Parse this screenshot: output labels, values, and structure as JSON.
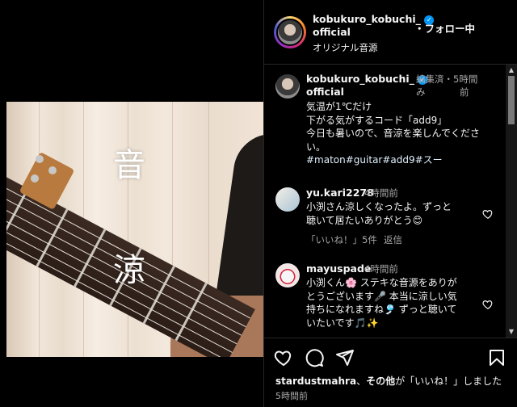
{
  "post": {
    "username_line1": "kobukuro_kobuchi_",
    "username_line2": "official",
    "follow_label": "・フォロー中",
    "audio_label": "オリジナル音源"
  },
  "overlay": {
    "char1": "音",
    "char2": "涼"
  },
  "caption": {
    "username_line1": "kobukuro_kobuchi_",
    "username_line2": "official",
    "edited_label": "編集済",
    "edited_label_2": "み",
    "dot": "・",
    "time_line1": "5時間",
    "time_line2": "前",
    "lines": [
      "気温が1℃だけ",
      "下がる気がするコード「add9」",
      "今日も暑いので、音涼を楽しんでくださ",
      "い。"
    ],
    "hashtags": "#maton#guitar#add9#スー"
  },
  "comments": [
    {
      "username": "yu.kari2278",
      "time": "4時間前",
      "text_lines": [
        "小渕さん涼しくなったよ。ずっと",
        "聴いて居たいありがとう😊"
      ],
      "likes_label": "「いいね！」5件",
      "reply_label": "返信"
    },
    {
      "username": "mayuspade",
      "time": "4時間前",
      "text_lines": [
        "小渕くん🌸 ステキな音源をありが",
        "とうございます🎤 本当に涼しい気",
        "持ちになれますね🎐 ずっと聴いて",
        "いたいです🎵✨"
      ]
    }
  ],
  "likes": {
    "user": "stardustmahra",
    "joiner": "、",
    "others": "その他",
    "suffix": "が「いいね！」しました"
  },
  "timestamp": "5時間前",
  "colors": {
    "verified": "#0095f6",
    "muted": "#a8a8a8",
    "border": "#262626"
  }
}
